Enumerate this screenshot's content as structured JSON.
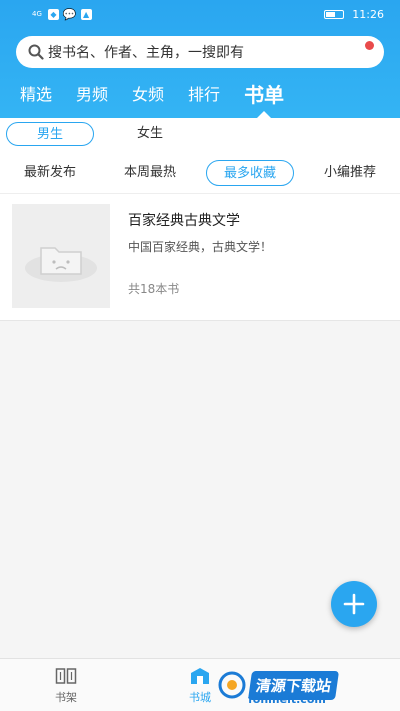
{
  "status_bar": {
    "time": "11:26",
    "signal": "4G"
  },
  "search": {
    "placeholder": "搜书名、作者、主角，一搜即有"
  },
  "tabs": [
    {
      "label": "精选"
    },
    {
      "label": "男频"
    },
    {
      "label": "女频"
    },
    {
      "label": "排行"
    },
    {
      "label": "书单"
    }
  ],
  "gender": {
    "male": "男生",
    "female": "女生"
  },
  "filters": [
    {
      "label": "最新发布"
    },
    {
      "label": "本周最热"
    },
    {
      "label": "最多收藏"
    },
    {
      "label": "小编推荐"
    }
  ],
  "booklist": [
    {
      "title": "百家经典古典文学",
      "desc": "中国百家经典，古典文学！",
      "count": "共18本书"
    }
  ],
  "bottom_nav": {
    "shelf": "书架",
    "store": "书城"
  },
  "watermark": {
    "main": "清源下载站",
    "sub": "fonmelt.com"
  },
  "colors": {
    "accent": "#2aa6f0",
    "badge": "#e94b4b"
  }
}
